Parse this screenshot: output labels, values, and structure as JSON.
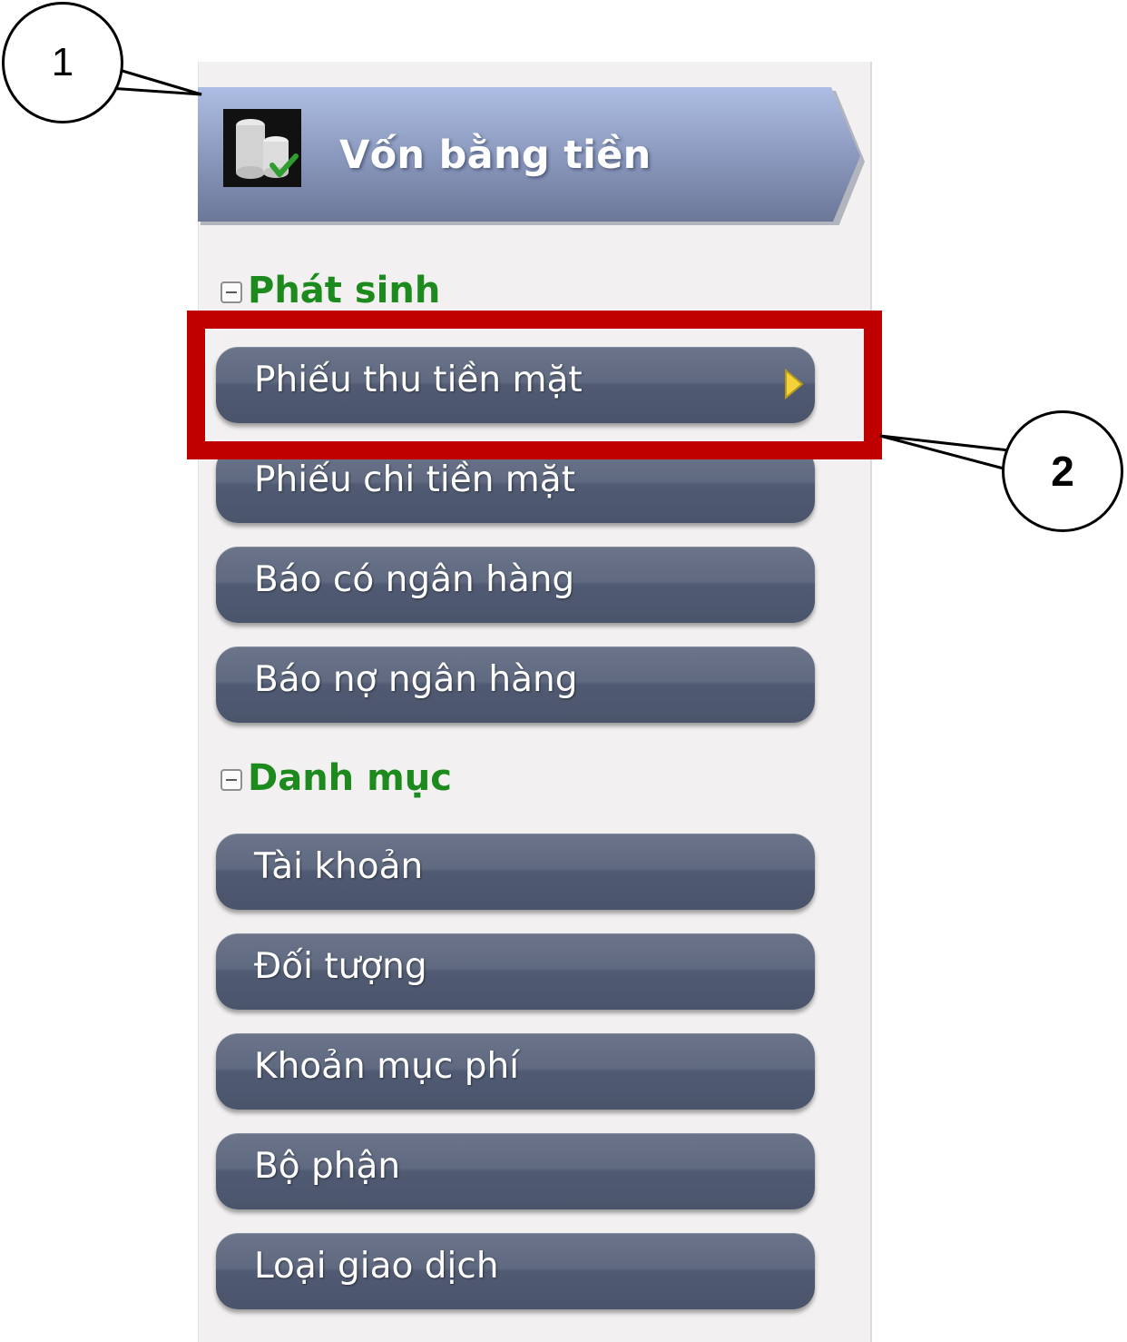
{
  "header": {
    "title": "Vốn bằng tiền",
    "icon": "coins-check-icon",
    "gradient_top": "#a9b8df",
    "gradient_bottom": "#6e7a9a"
  },
  "sections": [
    {
      "label": "Phát sinh",
      "expanded": true,
      "items": [
        {
          "label": "Phiếu thu tiền mặt",
          "selected": true
        },
        {
          "label": "Phiếu chi tiền mặt"
        },
        {
          "label": "Báo có ngân hàng"
        },
        {
          "label": "Báo nợ ngân hàng"
        }
      ]
    },
    {
      "label": "Danh mục",
      "expanded": true,
      "items": [
        {
          "label": "Tài khoản"
        },
        {
          "label": "Đối tượng"
        },
        {
          "label": "Khoản mục phí"
        },
        {
          "label": "Bộ phận"
        },
        {
          "label": "Loại giao dịch"
        }
      ]
    }
  ],
  "annotations": {
    "callout_1": "1",
    "callout_2": "2",
    "highlight_color": "#c00000"
  },
  "colors": {
    "section_heading": "#1d8a1d",
    "button_bg": "#5a637a",
    "panel_bg": "#f2f0f0",
    "selected_arrow": "#f2d43a"
  }
}
